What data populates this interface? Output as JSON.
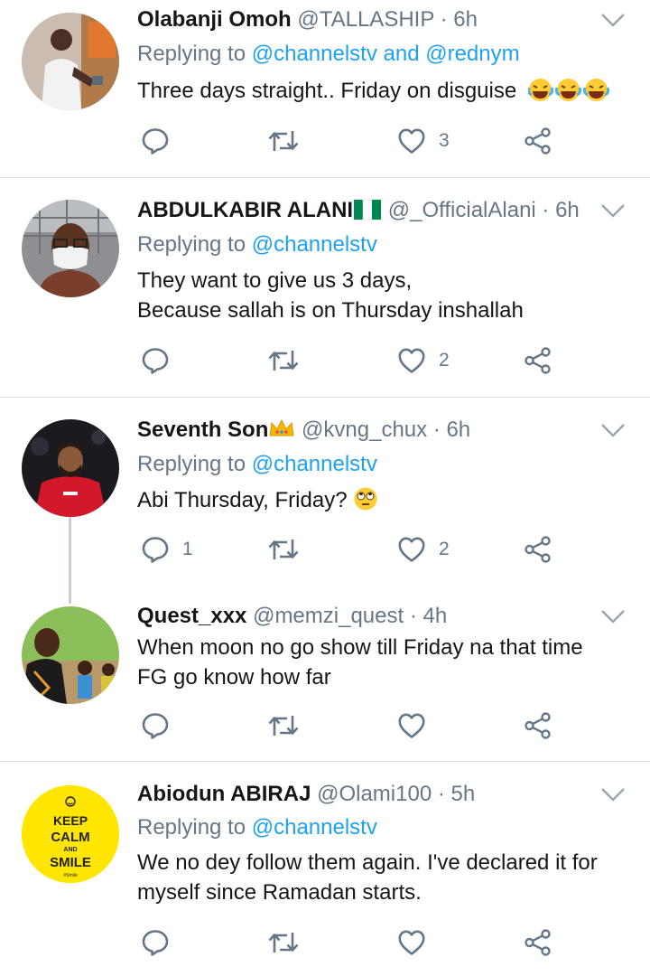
{
  "tweets": [
    {
      "name": "Olabanji Omoh",
      "handle": "@TALLASHIP · 6h",
      "reply_prefix": "Replying to",
      "reply_mentions": "@channelstv and @rednym",
      "text_lines": [
        "Three days straight.. Friday on disguise"
      ],
      "emoji": "😂😂😂",
      "reply_count": "",
      "retweet_count": "",
      "like_count": "3"
    },
    {
      "name": "ABDULKABIR ALANI",
      "handle": "@_OfficialAlani · 6h",
      "reply_prefix": "Replying to",
      "reply_mentions": "@channelstv",
      "text_lines": [
        "They want to give us 3 days,",
        "Because sallah is on Thursday inshallah"
      ],
      "reply_count": "",
      "retweet_count": "",
      "like_count": "2"
    },
    {
      "name": "Seventh Son",
      "handle": "@kvng_chux · 6h",
      "reply_prefix": "Replying to",
      "reply_mentions": "@channelstv",
      "text_lines": [
        "Abi Thursday, Friday?"
      ],
      "emoji": "🙄",
      "reply_count": "1",
      "retweet_count": "",
      "like_count": "2"
    },
    {
      "name": "Quest_xxx",
      "handle": "@memzi_quest · 4h",
      "text_lines": [
        "When moon no go show till Friday na that time",
        "FG go know how far"
      ],
      "reply_count": "",
      "retweet_count": "",
      "like_count": ""
    },
    {
      "name": "Abiodun ABIRAJ",
      "handle": "@Olami100 · 5h",
      "reply_prefix": "Replying to",
      "reply_mentions": "@channelstv",
      "text_lines": [
        "We no dey follow them again. I've declared it for",
        "myself since Ramadan starts."
      ],
      "avatar_text": [
        "KEEP",
        "CALM",
        "AND",
        "SMILE",
        "#Smile"
      ],
      "reply_count": "",
      "retweet_count": "",
      "like_count": ""
    }
  ],
  "colors": {
    "text": "#14171a",
    "secondary": "#657786",
    "link": "#1da1f2",
    "divider": "#d8dde2",
    "flag_green": "#008751",
    "crown_yellow": "#f5b800",
    "avatar5_bg": "#ffe600"
  },
  "icons": [
    "reply-icon",
    "retweet-icon",
    "like-icon",
    "share-icon",
    "chevron-down-icon",
    "nigeria-flag-icon",
    "crown-icon"
  ]
}
